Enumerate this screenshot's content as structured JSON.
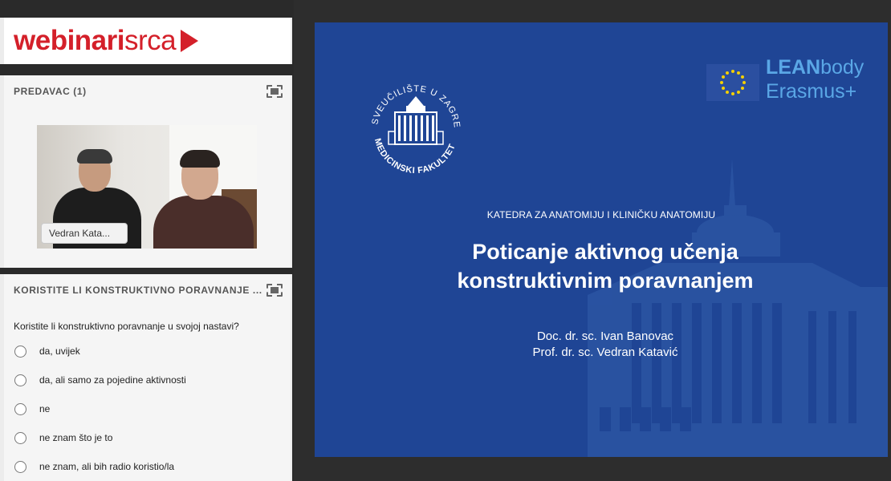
{
  "brand": {
    "logo_bold": "webinari",
    "logo_light": "srca"
  },
  "presenter_pod": {
    "title": "PREDAVAC (1)",
    "name_tag": "Vedran Kata..."
  },
  "poll_pod": {
    "title": "KORISTITE LI KONSTRUKTIVNO PORAVNANJE ...",
    "question": "Koristite li konstruktivno poravnanje u svojoj nastavi?",
    "options": [
      "da, uvijek",
      "da, ali samo za pojedine aktivnosti",
      "ne",
      "ne znam što je to",
      "ne znam, ali bih radio koristio/la"
    ]
  },
  "slide": {
    "university_logo_text": "SVEUČILIŠTE U ZAGREBU MEDICINSKI FAKULTET",
    "lean_bold": "LEAN",
    "lean_light": "body",
    "erasmus": "Erasmus+",
    "department": "KATEDRA ZA ANATOMIJU I KLINIČKU ANATOMIJU",
    "title_line1": "Poticanje aktivnog učenja",
    "title_line2": "konstruktivnim poravnanjem",
    "author1": "Doc. dr. sc. Ivan Banovac",
    "author2": "Prof. dr. sc. Vedran Katavić"
  },
  "colors": {
    "brand_red": "#d4202a",
    "slide_blue": "#1f4595",
    "lean_blue": "#5aa7e6"
  }
}
